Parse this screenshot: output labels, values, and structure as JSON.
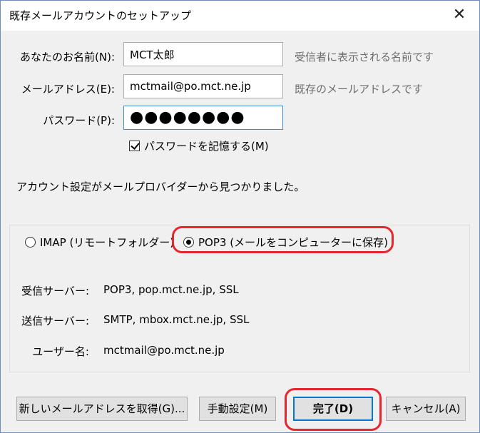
{
  "window": {
    "title": "既存メールアカウントのセットアップ",
    "close_glyph": "✕"
  },
  "form": {
    "name_label": "あなたのお名前(N):",
    "name_value": "MCT太郎",
    "name_hint": "受信者に表示される名前です",
    "email_label": "メールアドレス(E):",
    "email_value": "mctmail@po.mct.ne.jp",
    "email_hint": "既存のメールアドレスです",
    "password_label": "パスワード(P):",
    "password_value": "●●●●●●●●",
    "remember_label": "パスワードを記憶する(M)"
  },
  "status": {
    "found_text": "アカウント設定がメールプロバイダーから見つかりました。"
  },
  "protocol": {
    "imap_label": "IMAP (リモートフォルダー)",
    "pop3_label": "POP3 (メールをコンピューターに保存)",
    "selected": "POP3"
  },
  "server_info": {
    "incoming_label": "受信サーバー:",
    "incoming_value": "POP3, pop.mct.ne.jp, SSL",
    "outgoing_label": "送信サーバー:",
    "outgoing_value": "SMTP, mbox.mct.ne.jp, SSL",
    "username_label": "ユーザー名:",
    "username_value": "mctmail@po.mct.ne.jp"
  },
  "buttons": {
    "new_address": "新しいメールアドレスを取得(G)...",
    "manual": "手動設定(M)",
    "done": "完了(D)",
    "cancel": "キャンセル(A)"
  },
  "colors": {
    "highlight": "#e8262e",
    "focus_border": "#3f8bd6",
    "default_button_border": "#0078d7"
  }
}
